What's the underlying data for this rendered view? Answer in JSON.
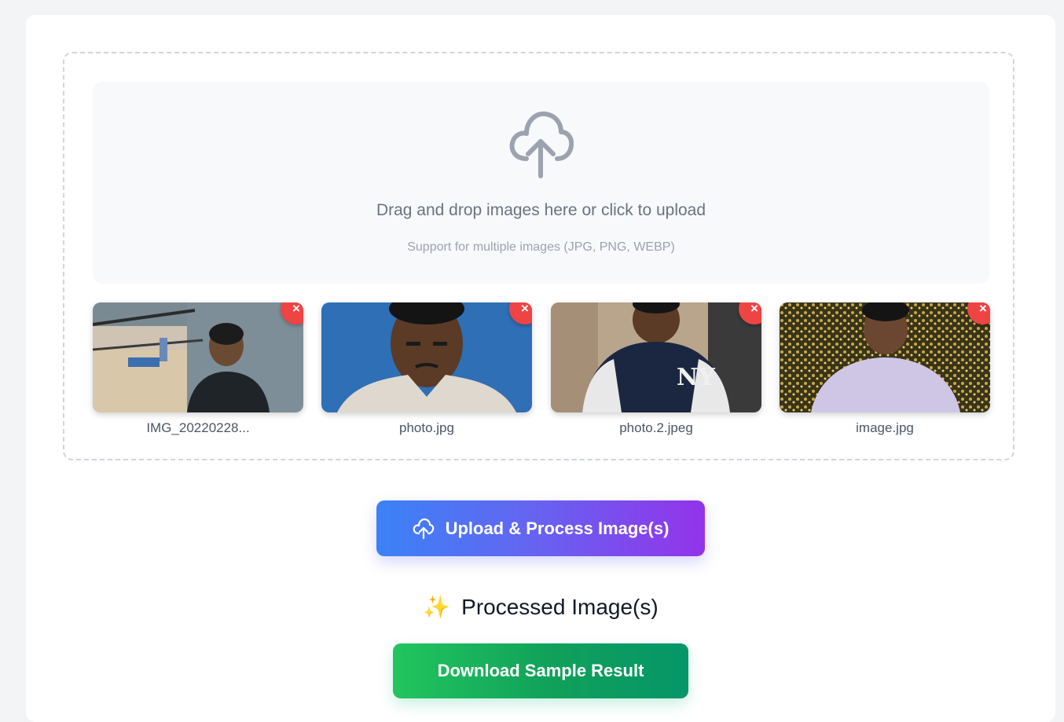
{
  "dropzone": {
    "title": "Drag and drop images here or click to upload",
    "subtitle": "Support for multiple images (JPG, PNG, WEBP)",
    "icon": "cloud-upload-icon"
  },
  "thumbnails": [
    {
      "name": "IMG_20220228...",
      "remove_label": "×"
    },
    {
      "name": "photo.jpg",
      "remove_label": "×"
    },
    {
      "name": "photo.2.jpeg",
      "remove_label": "×"
    },
    {
      "name": "image.jpg",
      "remove_label": "×"
    }
  ],
  "actions": {
    "upload_label": "Upload & Process Image(s)",
    "processed_title": "Processed Image(s)",
    "processed_emoji": "✨",
    "download_label": "Download Sample Result"
  },
  "colors": {
    "remove": "#ef4444",
    "upload_start": "#3b82f6",
    "upload_end": "#9333ea",
    "download_start": "#22c55e",
    "download_end": "#059669"
  }
}
